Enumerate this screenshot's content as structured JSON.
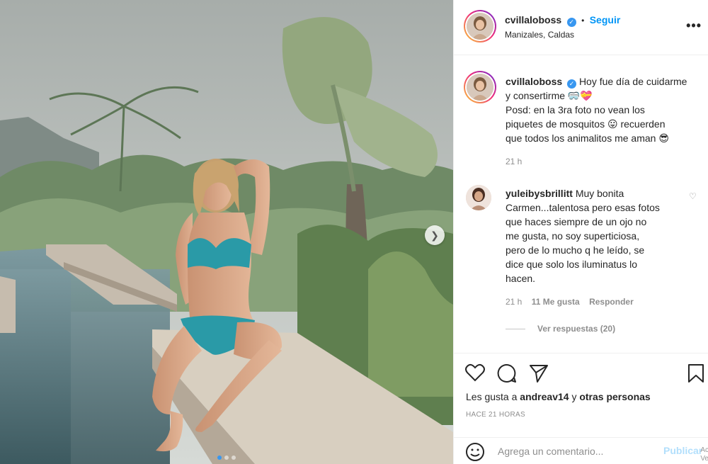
{
  "post": {
    "username": "cvillaloboss",
    "follow_label": "Seguir",
    "separator": "•",
    "location": "Manizales, Caldas",
    "more_label": "•••",
    "caption": {
      "line1": "Hoy fue día de cuidarme",
      "line2": "y consertirme 🥽💝",
      "line3": "Posd: en la 3ra foto no vean los",
      "line4": "piquetes de mosquitos 😛 recuerden",
      "line5": "que todos los animalitos me aman 😎",
      "time": "21 h"
    },
    "comment": {
      "username": "yuleibysbrillitt",
      "lines": [
        "Muy bonita",
        "Carmen...talentosa pero esas fotos",
        "que haces siempre de un ojo no",
        "me gusta, no soy superticiosa,",
        "pero de lo mucho q he leído, se",
        "dice que solo los iluminatus lo",
        "hacen."
      ],
      "time": "21 h",
      "likes": "11 Me gusta",
      "reply": "Responder",
      "view_replies": "Ver respuestas (20)"
    },
    "likes_prefix": "Les gusta a",
    "likes_user": "andreav14",
    "likes_joiner": "y",
    "likes_others": "otras personas",
    "timestamp": "HACE 21 HORAS",
    "add_comment_placeholder": "Agrega un comentario...",
    "publish_label": "Publicar",
    "watermark_line1": "Ac",
    "watermark_line2": "Ve"
  },
  "carousel": {
    "dots": 3,
    "active_index": 0
  },
  "colors": {
    "accent": "#0095f6",
    "text": "#262626",
    "muted": "#8e8e8e",
    "verified": "#3897f0"
  },
  "icons": [
    "verified-icon",
    "more-icon",
    "heart-icon",
    "comment-icon",
    "share-icon",
    "bookmark-icon",
    "emoji-icon",
    "next-arrow-icon"
  ]
}
